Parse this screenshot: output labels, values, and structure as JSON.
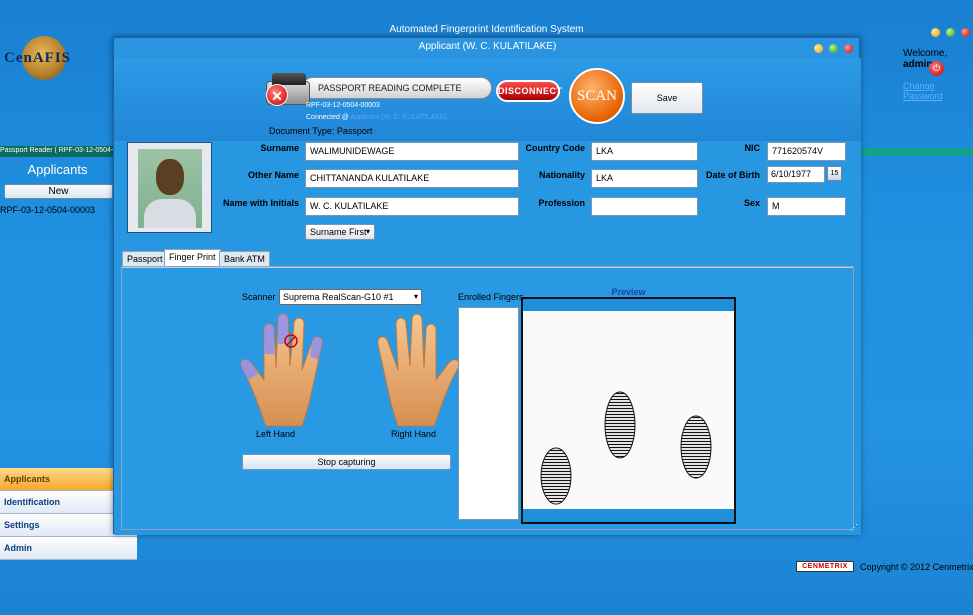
{
  "background_app": {
    "title": "Automated Fingerprint Identification System",
    "logo_text": "CenAFIS",
    "welcome_prefix": "Welcome,",
    "user": "admin",
    "change_password": "Change Password",
    "passport_reader_tab": "Passport Reader ( RPF-03-12-0504-",
    "sidebar_title": "Applicants",
    "new_button": "New",
    "sidebar_item": "RPF-03-12-0504-00003",
    "nav": [
      "Applicants",
      "Identification",
      "Settings",
      "Admin"
    ],
    "footer_logo": "CENMETRIX",
    "footer_copyright": "Copyright © 2012 Cenmetrix"
  },
  "dialog": {
    "title": "Applicant (W. C. KULATILAKE)",
    "status": "PASSPORT READING COMPLETE",
    "disconnect": "DISCONNECT",
    "scan": "SCAN",
    "save": "Save",
    "document_id": "RPF-03-12-0504-00003",
    "connected_label": "Connected @",
    "connected_device": "Applicant (W. C. KULATILAKE)",
    "document_type": "Document Type: Passport"
  },
  "form": {
    "surname_label": "Surname",
    "surname": "WALIMUNIDEWAGE",
    "other_name_label": "Other Name",
    "other_name": "CHITTANANDA KULATILAKE",
    "initials_label": "Name with Initials",
    "initials": "W. C. KULATILAKE",
    "country_code_label": "Country Code",
    "country_code": "LKA",
    "nationality_label": "Nationality",
    "nationality": "LKA",
    "profession_label": "Profession",
    "profession": "",
    "nic_label": "NIC",
    "nic": "771620574V",
    "dob_label": "Date of Birth",
    "dob": "6/10/1977",
    "dob_cal": "15",
    "sex_label": "Sex",
    "sex": "M",
    "name_order": "Surname First"
  },
  "tabs": [
    "Passport",
    "Finger Print",
    "Bank ATM"
  ],
  "fingerprint": {
    "scanner_label": "Scanner",
    "scanner": "Suprema RealScan-G10 #1",
    "left_hand": "Left Hand",
    "right_hand": "Right Hand",
    "stop_button": "Stop capturing",
    "enrolled_label": "Enrolled Fingers",
    "preview_label": "Preview"
  }
}
